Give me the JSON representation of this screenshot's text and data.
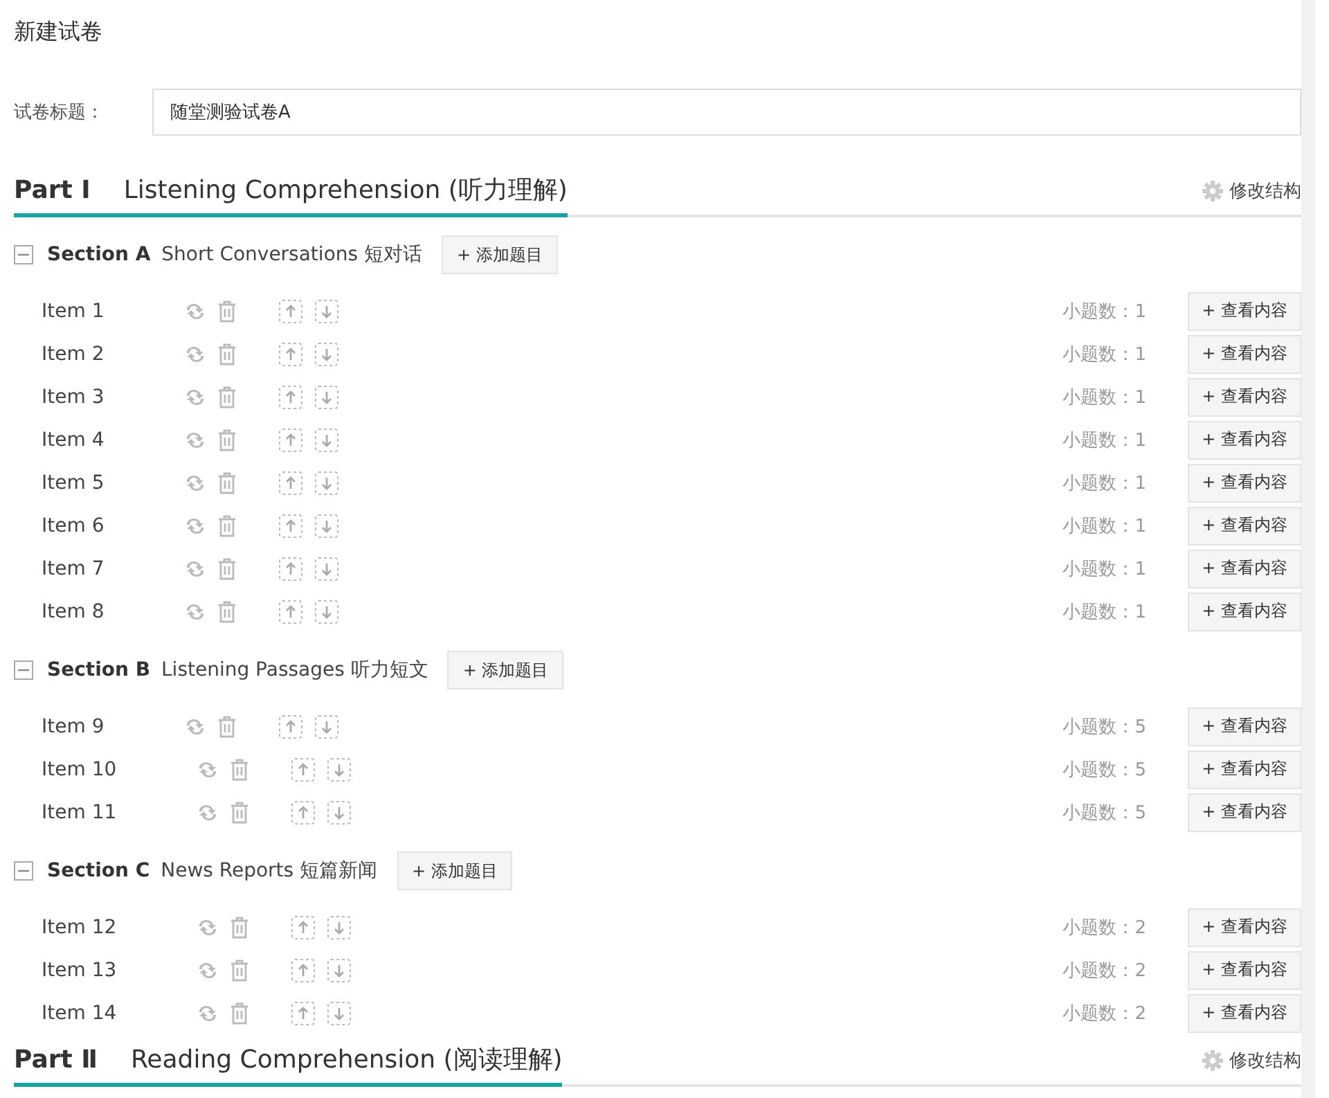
{
  "page_title": "新建试卷",
  "title_field": {
    "label": "试卷标题：",
    "value": "随堂测验试卷A"
  },
  "parts": [
    {
      "number": "Part Ⅰ",
      "title": "Listening Comprehension (听力理解)",
      "edit_label": "修改结构",
      "sections": [
        {
          "name": "Section A",
          "title": "Short Conversations 短对话",
          "expanded": true,
          "add_label": "+ 添加题目",
          "items": [
            {
              "name": "Item 1",
              "count": "小题数：1",
              "view_label": "+ 查看内容"
            },
            {
              "name": "Item 2",
              "count": "小题数：1",
              "view_label": "+ 查看内容"
            },
            {
              "name": "Item 3",
              "count": "小题数：1",
              "view_label": "+ 查看内容"
            },
            {
              "name": "Item 4",
              "count": "小题数：1",
              "view_label": "+ 查看内容"
            },
            {
              "name": "Item 5",
              "count": "小题数：1",
              "view_label": "+ 查看内容"
            },
            {
              "name": "Item 6",
              "count": "小题数：1",
              "view_label": "+ 查看内容"
            },
            {
              "name": "Item 7",
              "count": "小题数：1",
              "view_label": "+ 查看内容"
            },
            {
              "name": "Item 8",
              "count": "小题数：1",
              "view_label": "+ 查看内容"
            }
          ]
        },
        {
          "name": "Section B",
          "title": "Listening Passages 听力短文",
          "expanded": true,
          "add_label": "+ 添加题目",
          "items": [
            {
              "name": "Item 9",
              "count": "小题数：5",
              "view_label": "+ 查看内容"
            },
            {
              "name": "Item 10",
              "count": "小题数：5",
              "view_label": "+ 查看内容"
            },
            {
              "name": "Item 11",
              "count": "小题数：5",
              "view_label": "+ 查看内容"
            }
          ]
        },
        {
          "name": "Section C",
          "title": "News Reports 短篇新闻",
          "expanded": true,
          "add_label": "+ 添加题目",
          "items": [
            {
              "name": "Item 12",
              "count": "小题数：2",
              "view_label": "+ 查看内容"
            },
            {
              "name": "Item 13",
              "count": "小题数：2",
              "view_label": "+ 查看内容"
            },
            {
              "name": "Item 14",
              "count": "小题数：2",
              "view_label": "+ 查看内容"
            }
          ]
        }
      ]
    },
    {
      "number": "Part Ⅱ",
      "title": "Reading Comprehension (阅读理解)",
      "edit_label": "修改结构"
    }
  ]
}
